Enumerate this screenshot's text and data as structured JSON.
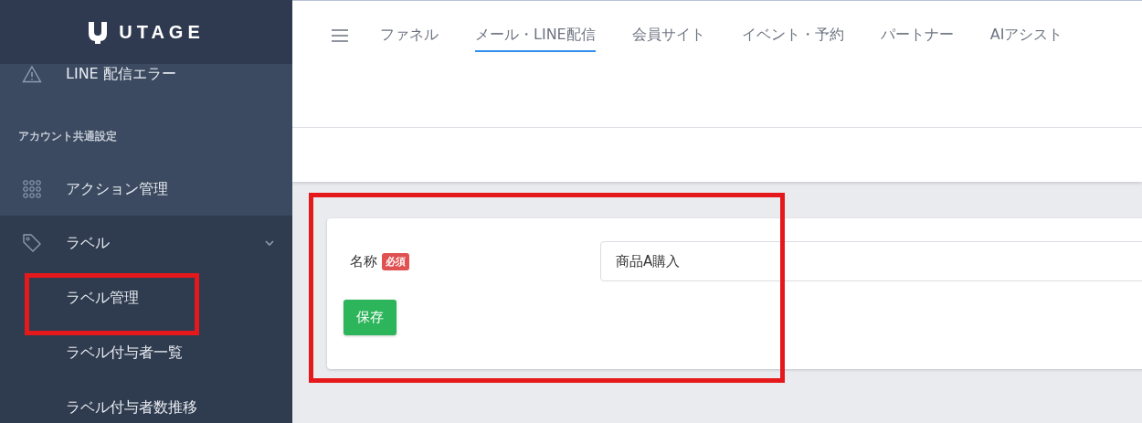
{
  "logo": {
    "text": "UTAGE"
  },
  "sidebar": {
    "items": [
      {
        "kind": "link",
        "label": "LINE 配信エラー",
        "highlighted": false
      },
      {
        "kind": "section",
        "label": "アカウント共通設定"
      },
      {
        "kind": "link",
        "label": "アクション管理",
        "highlighted": false
      },
      {
        "kind": "group",
        "label": "ラベル",
        "expanded": true,
        "children": [
          {
            "label": "ラベル管理",
            "highlighted": true
          },
          {
            "label": "ラベル付与者一覧",
            "highlighted": false
          },
          {
            "label": "ラベル付与者数推移",
            "highlighted": false
          }
        ]
      }
    ]
  },
  "top_nav": {
    "tabs": [
      {
        "label": "ファネル",
        "selected": false
      },
      {
        "label": "メール・LINE配信",
        "selected": true
      },
      {
        "label": "会員サイト",
        "selected": false
      },
      {
        "label": "イベント・予約",
        "selected": false
      },
      {
        "label": "パートナー",
        "selected": false
      },
      {
        "label": "AIアシスト",
        "selected": false
      }
    ]
  },
  "form": {
    "highlighted": true,
    "field_label": "名称",
    "required_badge": "必須",
    "value": "商品A購入",
    "save_button": "保存"
  }
}
